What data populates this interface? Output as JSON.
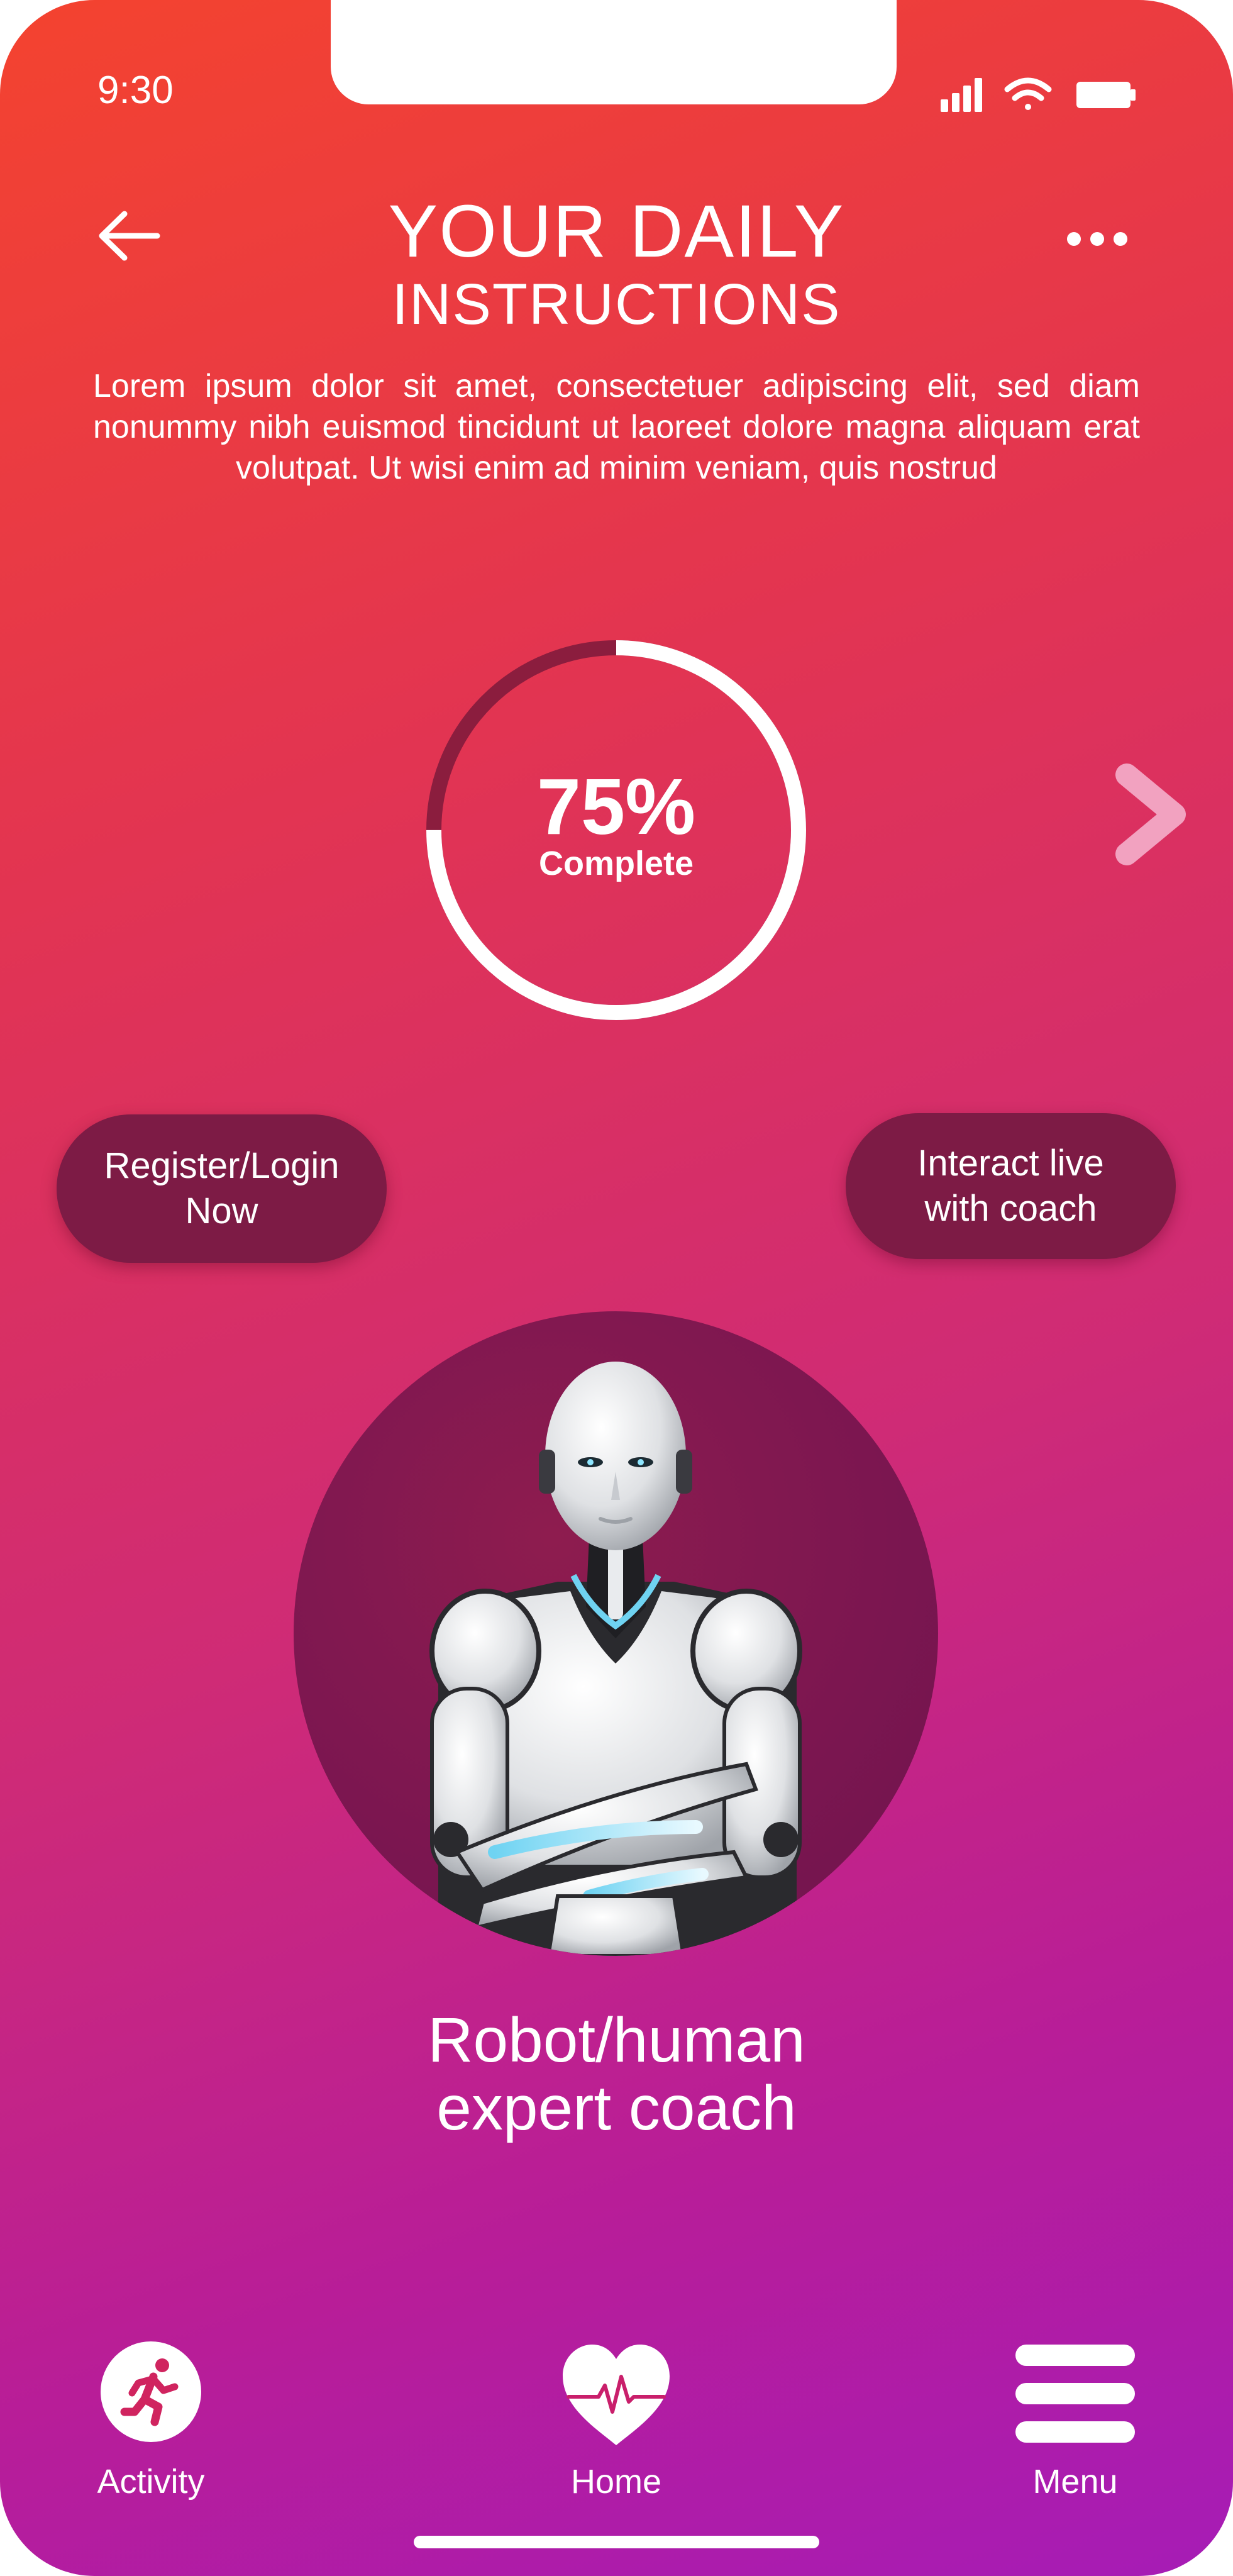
{
  "status_bar": {
    "time": "9:30",
    "icons": [
      "signal-icon",
      "wifi-icon",
      "battery-icon"
    ]
  },
  "header": {
    "title_line1": "YOUR DAILY",
    "title_line2": "INSTRUCTIONS",
    "back_icon": "arrow-left-icon",
    "more_icon": "more-horizontal-icon"
  },
  "description": "Lorem ipsum dolor sit amet, consectetuer adipiscing elit, sed diam nonummy nibh euismod tincidunt ut laoreet dolore magna aliquam erat volutpat. Ut wisi enim ad minim veniam, quis nostrud",
  "progress": {
    "value_percent": 75,
    "value_label": "75%",
    "caption": "Complete"
  },
  "actions": {
    "register_label": "Register/Login Now",
    "coach_label": "Interact live with coach"
  },
  "coach": {
    "caption": "Robot/human expert coach"
  },
  "bottom_nav": {
    "items": [
      {
        "label": "Activity",
        "icon": "running-person-icon"
      },
      {
        "label": "Home",
        "icon": "heart-pulse-icon"
      },
      {
        "label": "Menu",
        "icon": "hamburger-menu-icon"
      }
    ]
  },
  "colors": {
    "gradient_top": "#f4432f",
    "gradient_bottom": "#a61cb6",
    "pill_background": "#7d1b45",
    "ring_track": "#8b1d3e",
    "ring_fill": "#ffffff",
    "chevron": "#f2a2c0"
  }
}
